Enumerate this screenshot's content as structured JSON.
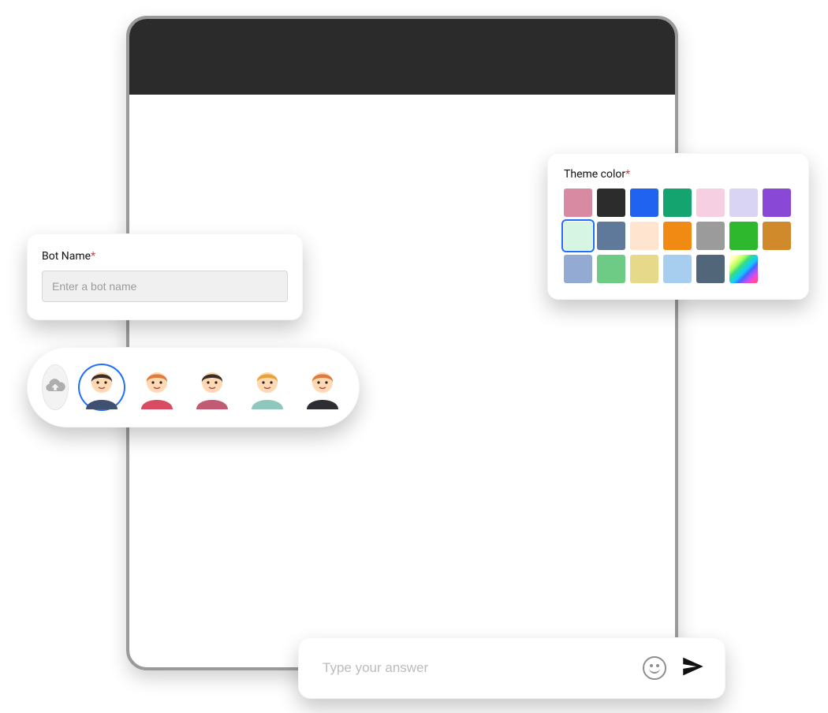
{
  "bot_name": {
    "label": "Bot Name",
    "required_mark": "*",
    "placeholder": "Enter a bot name",
    "value": ""
  },
  "avatars": {
    "upload_label": "upload",
    "options": [
      {
        "id": "avatar-1",
        "selected": true,
        "hair": "#3a2b23",
        "skin": "#ffd9b3",
        "shirt": "#405070"
      },
      {
        "id": "avatar-2",
        "selected": false,
        "hair": "#e07a3c",
        "skin": "#ffd9b3",
        "shirt": "#d84b62"
      },
      {
        "id": "avatar-3",
        "selected": false,
        "hair": "#3a2b23",
        "skin": "#ffd9b3",
        "shirt": "#c15a72"
      },
      {
        "id": "avatar-4",
        "selected": false,
        "hair": "#e8a23a",
        "skin": "#ffd9b3",
        "shirt": "#8fc7bd"
      },
      {
        "id": "avatar-5",
        "selected": false,
        "hair": "#e07a3c",
        "skin": "#ffd9b3",
        "shirt": "#2d2d33"
      }
    ]
  },
  "theme": {
    "label": "Theme color",
    "required_mark": "*",
    "selected": 7,
    "colors": [
      "#d88aa3",
      "#2c2c2c",
      "#1f63f0",
      "#13a46f",
      "#f6cfe2",
      "#d9d3f4",
      "#8948d6",
      "#d6f5e3",
      "#5f799a",
      "#ffe4cf",
      "#f08a12",
      "#9b9b9b",
      "#2db82d",
      "#d08a2c",
      "#93aad2",
      "#6ecb86",
      "#e6d98a",
      "#a7cdef",
      "#516678",
      "custom"
    ]
  },
  "answer": {
    "placeholder": "Type your answer",
    "value": ""
  }
}
